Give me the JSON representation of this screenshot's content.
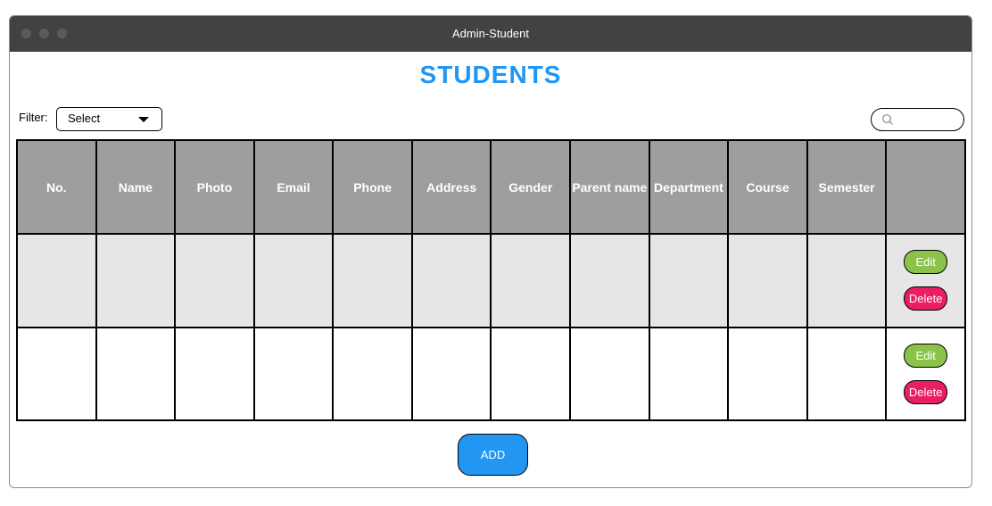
{
  "window": {
    "title": "Admin-Student"
  },
  "page": {
    "title": "STUDENTS"
  },
  "filter": {
    "label": "Filter:",
    "selected": "Select"
  },
  "table": {
    "columns": [
      "No.",
      "Name",
      "Photo",
      "Email",
      "Phone",
      "Address",
      "Gender",
      "Parent name",
      "Department",
      "Course",
      "Semester",
      ""
    ],
    "rows": [
      {
        "edit_label": "Edit",
        "delete_label": "Delete"
      },
      {
        "edit_label": "Edit",
        "delete_label": "Delete"
      }
    ]
  },
  "add_button": {
    "label": "ADD"
  },
  "colors": {
    "accent": "#2196f3",
    "header_bg": "#9e9e9e",
    "edit": "#8bc34a",
    "delete": "#e91e63",
    "titlebar": "#424242"
  }
}
